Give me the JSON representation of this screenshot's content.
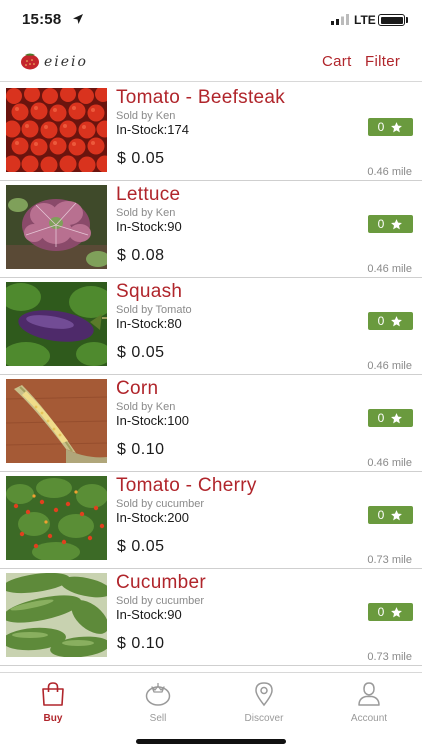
{
  "status_bar": {
    "time": "15:58",
    "network": "LTE"
  },
  "header": {
    "logo_text": "eieio",
    "cart_label": "Cart",
    "filter_label": "Filter",
    "accent_color": "#b0252b"
  },
  "products": [
    {
      "name": "Tomato - Beefsteak",
      "seller": "",
      "seller_display": "Sold by Ken",
      "stock": "In-Stock:174",
      "price": "$ 0.05",
      "rating": "0",
      "distance": "0.46 mile",
      "image": "tomatoes"
    },
    {
      "name": "Lettuce",
      "seller_display": "Sold by Ken",
      "stock": "In-Stock:90",
      "price": "$ 0.08",
      "rating": "0",
      "distance": "0.46 mile",
      "image": "lettuce"
    },
    {
      "name": "Squash",
      "seller_display": "Sold by Tomato",
      "stock": "In-Stock:80",
      "price": "$ 0.05",
      "rating": "0",
      "distance": "0.46 mile",
      "image": "eggplant"
    },
    {
      "name": "Corn",
      "seller_display": "Sold by Ken",
      "stock": "In-Stock:100",
      "price": "$ 0.10",
      "rating": "0",
      "distance": "0.46 mile",
      "image": "corn"
    },
    {
      "name": "Tomato - Cherry",
      "seller_display": "Sold by cucumber",
      "stock": "In-Stock:200",
      "price": "$ 0.05",
      "rating": "0",
      "distance": "0.73 mile",
      "image": "cherry-tomato-plants"
    },
    {
      "name": "Cucumber",
      "seller_display": "Sold by cucumber",
      "stock": "In-Stock:90",
      "price": "$ 0.10",
      "rating": "0",
      "distance": "0.73 mile",
      "image": "cucumbers"
    }
  ],
  "tabs": [
    {
      "label": "Buy",
      "icon": "shopping-bag-icon",
      "active": true
    },
    {
      "label": "Sell",
      "icon": "tomato-icon",
      "active": false
    },
    {
      "label": "Discover",
      "icon": "location-pin-icon",
      "active": false
    },
    {
      "label": "Account",
      "icon": "person-icon",
      "active": false
    }
  ],
  "colors": {
    "accent": "#b0252b",
    "rating_badge": "#6a9a3e"
  }
}
